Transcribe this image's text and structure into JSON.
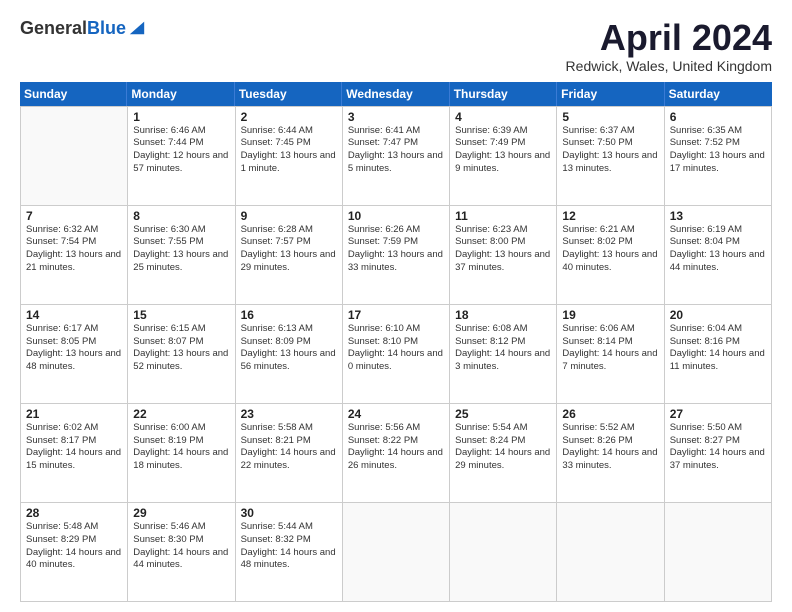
{
  "logo": {
    "general": "General",
    "blue": "Blue"
  },
  "header": {
    "month": "April 2024",
    "location": "Redwick, Wales, United Kingdom"
  },
  "weekdays": [
    "Sunday",
    "Monday",
    "Tuesday",
    "Wednesday",
    "Thursday",
    "Friday",
    "Saturday"
  ],
  "weeks": [
    [
      {
        "day": "",
        "sunrise": "",
        "sunset": "",
        "daylight": ""
      },
      {
        "day": "1",
        "sunrise": "Sunrise: 6:46 AM",
        "sunset": "Sunset: 7:44 PM",
        "daylight": "Daylight: 12 hours and 57 minutes."
      },
      {
        "day": "2",
        "sunrise": "Sunrise: 6:44 AM",
        "sunset": "Sunset: 7:45 PM",
        "daylight": "Daylight: 13 hours and 1 minute."
      },
      {
        "day": "3",
        "sunrise": "Sunrise: 6:41 AM",
        "sunset": "Sunset: 7:47 PM",
        "daylight": "Daylight: 13 hours and 5 minutes."
      },
      {
        "day": "4",
        "sunrise": "Sunrise: 6:39 AM",
        "sunset": "Sunset: 7:49 PM",
        "daylight": "Daylight: 13 hours and 9 minutes."
      },
      {
        "day": "5",
        "sunrise": "Sunrise: 6:37 AM",
        "sunset": "Sunset: 7:50 PM",
        "daylight": "Daylight: 13 hours and 13 minutes."
      },
      {
        "day": "6",
        "sunrise": "Sunrise: 6:35 AM",
        "sunset": "Sunset: 7:52 PM",
        "daylight": "Daylight: 13 hours and 17 minutes."
      }
    ],
    [
      {
        "day": "7",
        "sunrise": "Sunrise: 6:32 AM",
        "sunset": "Sunset: 7:54 PM",
        "daylight": "Daylight: 13 hours and 21 minutes."
      },
      {
        "day": "8",
        "sunrise": "Sunrise: 6:30 AM",
        "sunset": "Sunset: 7:55 PM",
        "daylight": "Daylight: 13 hours and 25 minutes."
      },
      {
        "day": "9",
        "sunrise": "Sunrise: 6:28 AM",
        "sunset": "Sunset: 7:57 PM",
        "daylight": "Daylight: 13 hours and 29 minutes."
      },
      {
        "day": "10",
        "sunrise": "Sunrise: 6:26 AM",
        "sunset": "Sunset: 7:59 PM",
        "daylight": "Daylight: 13 hours and 33 minutes."
      },
      {
        "day": "11",
        "sunrise": "Sunrise: 6:23 AM",
        "sunset": "Sunset: 8:00 PM",
        "daylight": "Daylight: 13 hours and 37 minutes."
      },
      {
        "day": "12",
        "sunrise": "Sunrise: 6:21 AM",
        "sunset": "Sunset: 8:02 PM",
        "daylight": "Daylight: 13 hours and 40 minutes."
      },
      {
        "day": "13",
        "sunrise": "Sunrise: 6:19 AM",
        "sunset": "Sunset: 8:04 PM",
        "daylight": "Daylight: 13 hours and 44 minutes."
      }
    ],
    [
      {
        "day": "14",
        "sunrise": "Sunrise: 6:17 AM",
        "sunset": "Sunset: 8:05 PM",
        "daylight": "Daylight: 13 hours and 48 minutes."
      },
      {
        "day": "15",
        "sunrise": "Sunrise: 6:15 AM",
        "sunset": "Sunset: 8:07 PM",
        "daylight": "Daylight: 13 hours and 52 minutes."
      },
      {
        "day": "16",
        "sunrise": "Sunrise: 6:13 AM",
        "sunset": "Sunset: 8:09 PM",
        "daylight": "Daylight: 13 hours and 56 minutes."
      },
      {
        "day": "17",
        "sunrise": "Sunrise: 6:10 AM",
        "sunset": "Sunset: 8:10 PM",
        "daylight": "Daylight: 14 hours and 0 minutes."
      },
      {
        "day": "18",
        "sunrise": "Sunrise: 6:08 AM",
        "sunset": "Sunset: 8:12 PM",
        "daylight": "Daylight: 14 hours and 3 minutes."
      },
      {
        "day": "19",
        "sunrise": "Sunrise: 6:06 AM",
        "sunset": "Sunset: 8:14 PM",
        "daylight": "Daylight: 14 hours and 7 minutes."
      },
      {
        "day": "20",
        "sunrise": "Sunrise: 6:04 AM",
        "sunset": "Sunset: 8:16 PM",
        "daylight": "Daylight: 14 hours and 11 minutes."
      }
    ],
    [
      {
        "day": "21",
        "sunrise": "Sunrise: 6:02 AM",
        "sunset": "Sunset: 8:17 PM",
        "daylight": "Daylight: 14 hours and 15 minutes."
      },
      {
        "day": "22",
        "sunrise": "Sunrise: 6:00 AM",
        "sunset": "Sunset: 8:19 PM",
        "daylight": "Daylight: 14 hours and 18 minutes."
      },
      {
        "day": "23",
        "sunrise": "Sunrise: 5:58 AM",
        "sunset": "Sunset: 8:21 PM",
        "daylight": "Daylight: 14 hours and 22 minutes."
      },
      {
        "day": "24",
        "sunrise": "Sunrise: 5:56 AM",
        "sunset": "Sunset: 8:22 PM",
        "daylight": "Daylight: 14 hours and 26 minutes."
      },
      {
        "day": "25",
        "sunrise": "Sunrise: 5:54 AM",
        "sunset": "Sunset: 8:24 PM",
        "daylight": "Daylight: 14 hours and 29 minutes."
      },
      {
        "day": "26",
        "sunrise": "Sunrise: 5:52 AM",
        "sunset": "Sunset: 8:26 PM",
        "daylight": "Daylight: 14 hours and 33 minutes."
      },
      {
        "day": "27",
        "sunrise": "Sunrise: 5:50 AM",
        "sunset": "Sunset: 8:27 PM",
        "daylight": "Daylight: 14 hours and 37 minutes."
      }
    ],
    [
      {
        "day": "28",
        "sunrise": "Sunrise: 5:48 AM",
        "sunset": "Sunset: 8:29 PM",
        "daylight": "Daylight: 14 hours and 40 minutes."
      },
      {
        "day": "29",
        "sunrise": "Sunrise: 5:46 AM",
        "sunset": "Sunset: 8:30 PM",
        "daylight": "Daylight: 14 hours and 44 minutes."
      },
      {
        "day": "30",
        "sunrise": "Sunrise: 5:44 AM",
        "sunset": "Sunset: 8:32 PM",
        "daylight": "Daylight: 14 hours and 48 minutes."
      },
      {
        "day": "",
        "sunrise": "",
        "sunset": "",
        "daylight": ""
      },
      {
        "day": "",
        "sunrise": "",
        "sunset": "",
        "daylight": ""
      },
      {
        "day": "",
        "sunrise": "",
        "sunset": "",
        "daylight": ""
      },
      {
        "day": "",
        "sunrise": "",
        "sunset": "",
        "daylight": ""
      }
    ]
  ]
}
